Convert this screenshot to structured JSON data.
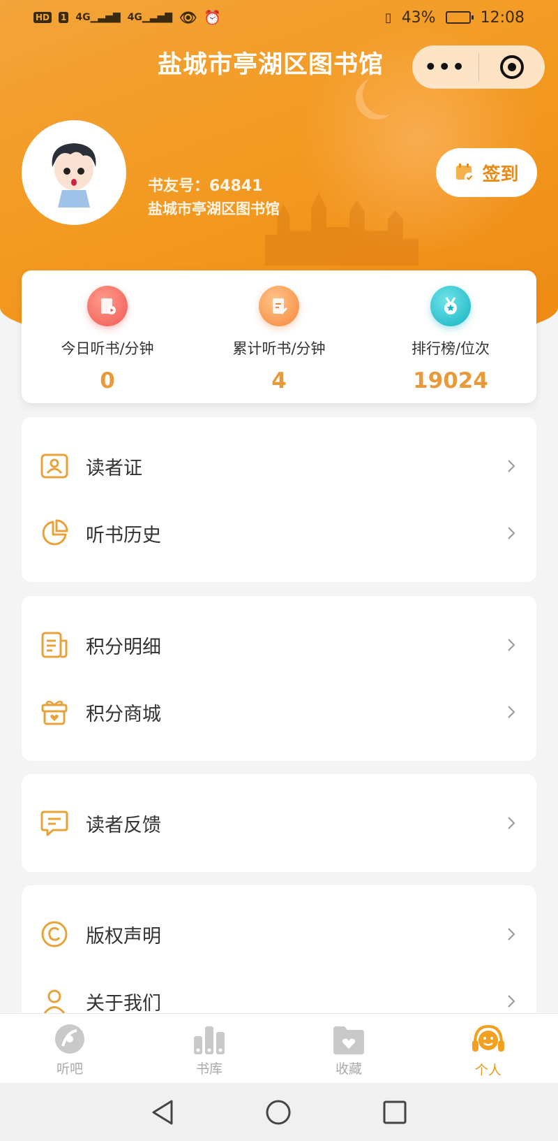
{
  "status_bar": {
    "left_chip1": "HD",
    "left_chip2": "1",
    "signal1": "4G",
    "signal2": "4G",
    "battery_percent": "43%",
    "time": "12:08"
  },
  "header": {
    "title": "盐城市亭湖区图书馆",
    "more_label": "•••"
  },
  "profile": {
    "user_id": "书友号：64841",
    "library": "盐城市亭湖区图书馆",
    "checkin_label": "签到"
  },
  "stats": [
    {
      "label": "今日听书/分钟",
      "value": "0",
      "icon": "book-play-icon",
      "color": "#f56b62"
    },
    {
      "label": "累计听书/分钟",
      "value": "4",
      "icon": "book-edit-icon",
      "color": "#f6913a"
    },
    {
      "label": "排行榜/位次",
      "value": "19024",
      "icon": "medal-icon",
      "color": "#1fbcc8"
    }
  ],
  "menu": {
    "group1": [
      "读者证",
      "听书历史"
    ],
    "group2": [
      "积分明细",
      "积分商城"
    ],
    "group3": [
      "读者反馈"
    ],
    "group4": [
      "版权声明",
      "关于我们"
    ]
  },
  "tabs": [
    {
      "label": "听吧",
      "icon": "disc-icon",
      "active": false
    },
    {
      "label": "书库",
      "icon": "library-icon",
      "active": false
    },
    {
      "label": "收藏",
      "icon": "heart-folder-icon",
      "active": false
    },
    {
      "label": "个人",
      "icon": "headphones-user-icon",
      "active": true
    }
  ],
  "colors": {
    "accent": "#e89a1c",
    "header": "#f39a22",
    "icon_line": "#e8a23a"
  }
}
